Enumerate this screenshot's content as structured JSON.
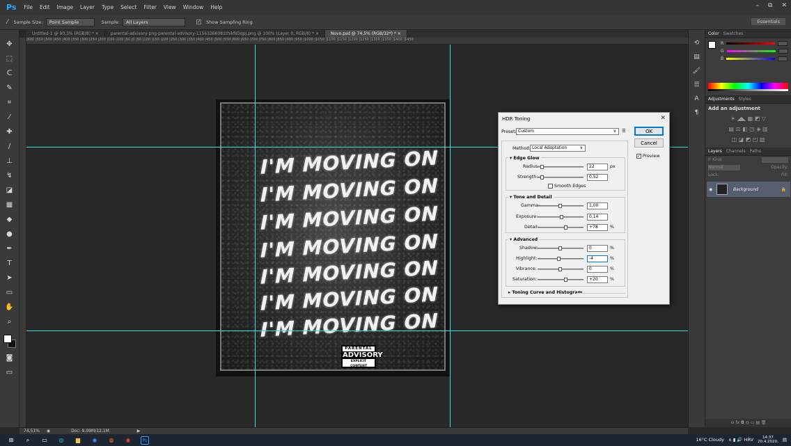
{
  "app": {
    "logo": "Ps",
    "menu": [
      "File",
      "Edit",
      "Image",
      "Layer",
      "Type",
      "Select",
      "Filter",
      "View",
      "Window",
      "Help"
    ],
    "window_controls": [
      "–",
      "⧉",
      "✕"
    ]
  },
  "options_bar": {
    "tool_glyph": "⁄",
    "sample_size_label": "Sample Size:",
    "sample_size_value": "Point Sample",
    "sample_label": "Sample:",
    "sample_value": "All Layers",
    "show_ring_label": "Show Sampling Ring",
    "show_ring_checked": "✓",
    "workspace": "Essentials"
  },
  "tabs": [
    {
      "label": "Untitled-1 @ 90,3% (RGB/8) *  ×"
    },
    {
      "label": "parental-advisory-png-parental-advisory-11563266081thikfd3qpj.png @ 100% (Layer 0, RGB/8) *  ×"
    },
    {
      "label": "Novo.psd @ 74,5% (RGB/32*) *  ×"
    }
  ],
  "ruler_ticks": "|600    |550    |500    |450    |400    |350    |300    |250    |200    |150    |100    |50     |0      |50     |100    |150    |200    |250    |300    |350    |400    |450    |500    |550    |600    |650    |700    |750    |800    |850    |900    |950    |1000   |1050   |1100   |1150   |1200   |1250   |1300   |1350   |1400   |1450",
  "artwork": {
    "lines": [
      "I'M MOVING ON",
      "I'M MOVING ON",
      "I'M MOVING ON",
      "I'M MOVING ON",
      "I'M MOVING ON",
      "I'M MOVING ON",
      "I'M MOVING ON"
    ],
    "advisory_top": "PARENTAL",
    "advisory_mid": "ADVISORY",
    "advisory_bottom": "EXPLICIT CONTENT"
  },
  "status": {
    "zoom": "74,51%",
    "doc": "Doc: 9,09M/12,1M",
    "arrow": "▶"
  },
  "right_panel": {
    "color_tabs": [
      "Color",
      "Swatches"
    ],
    "rgb_labels": [
      "R",
      "G",
      "B"
    ],
    "adj_tabs": [
      "Adjustments",
      "Styles"
    ],
    "adj_title": "Add an adjustment",
    "adj_icons_row1": "☀ ◢◣ ▦ ◩ ▽",
    "adj_icons_row2": "▤ ⚖ ◧ ◳ ◈ ▥",
    "adj_icons_row3": "◫ ◪ ◩ ◰ ▧",
    "layer_tabs": [
      "Layers",
      "Channels",
      "Paths"
    ],
    "kind_label": "ℙ Kind",
    "blend_mode": "Normal",
    "opacity_label": "Opacity:",
    "lock_label": "Lock:",
    "fill_label": "Fill:",
    "layer_name": "Background",
    "layer_lock": "🔒",
    "layer_eye": "◉",
    "bottom_icons": "⊖  fx  ◘  ◎  ▭  ▤  🗑"
  },
  "hdr_dialog": {
    "title": "HDR Toning",
    "close": "✕",
    "preset_label": "Preset:",
    "preset_value": "Custom",
    "preset_arrow": "∨",
    "preset_menu": "☰",
    "ok": "OK",
    "cancel": "Cancel",
    "preview_label": "Preview",
    "preview_checked": "✓",
    "method_label": "Method:",
    "method_value": "Local Adaptation",
    "method_arrow": "∨",
    "edge_glow": "Edge Glow",
    "radius_label": "Radius:",
    "radius_value": "22",
    "radius_unit": "px",
    "strength_label": "Strength:",
    "strength_value": "0,52",
    "smooth_edges": "Smooth Edges",
    "tone_detail": "Tone and Detail",
    "gamma_label": "Gamma:",
    "gamma_value": "1,00",
    "exposure_label": "Exposure:",
    "exposure_value": "0,14",
    "detail_label": "Detail:",
    "detail_value": "+78",
    "detail_unit": "%",
    "advanced": "Advanced",
    "shadow_label": "Shadow:",
    "shadow_value": "0",
    "shadow_unit": "%",
    "highlight_label": "Highlight:",
    "highlight_value": "-4",
    "highlight_unit": "%",
    "vibrance_label": "Vibrance:",
    "vibrance_value": "0",
    "vibrance_unit": "%",
    "saturation_label": "Saturation:",
    "saturation_value": "+20",
    "saturation_unit": "%",
    "toning_curve": "Toning Curve and Histogram",
    "section_arrow": "▾",
    "collapsed_arrow": "▸"
  },
  "taskbar": {
    "icons": [
      "⊞",
      "⌕",
      "▭",
      "◎",
      "▆",
      "◉",
      "◍",
      "◉",
      "Ps"
    ],
    "weather": "16°C  Cloudy",
    "tray": "∧  ▮  🔊  HRV",
    "time": "14:37",
    "date": "20.4.2020.",
    "notif": "▤"
  },
  "colors": {
    "guide": "#35e0e0",
    "accent": "#31a8ff",
    "layer_selected": "#565d6e"
  }
}
